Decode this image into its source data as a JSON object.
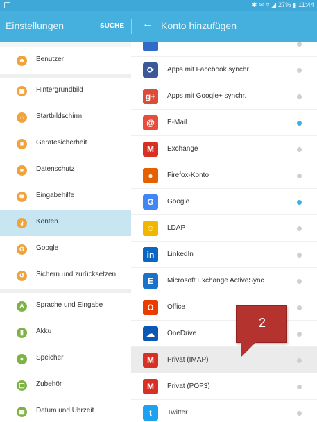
{
  "status": {
    "right": "✱ ✉ ▿ ◢ 27% ▮ 11:44"
  },
  "appbar": {
    "title": "Einstellungen",
    "search": "SUCHE",
    "back": "←",
    "subtitle": "Konto hinzufügen"
  },
  "left_items": [
    {
      "label": "Benutzer",
      "glyph": "☻"
    },
    {
      "label": "Hintergrundbild",
      "glyph": "▣"
    },
    {
      "label": "Startbildschirm",
      "glyph": "⌂"
    },
    {
      "label": "Gerätesicherheit",
      "glyph": "■"
    },
    {
      "label": "Datenschutz",
      "glyph": "■"
    },
    {
      "label": "Eingabehilfe",
      "glyph": "✱"
    },
    {
      "label": "Konten",
      "glyph": "⚷"
    },
    {
      "label": "Google",
      "glyph": "G"
    },
    {
      "label": "Sichern und zurücksetzen",
      "glyph": "↺"
    },
    {
      "label": "Sprache und Eingabe",
      "glyph": "A"
    },
    {
      "label": "Akku",
      "glyph": "▮"
    },
    {
      "label": "Speicher",
      "glyph": "●"
    },
    {
      "label": "Zubehör",
      "glyph": "◫"
    },
    {
      "label": "Datum und Uhrzeit",
      "glyph": "▦"
    }
  ],
  "right_items": [
    {
      "label": "Apps mit Facebook synchr.",
      "glyph": "⟳",
      "color": "#3b5998",
      "active": false
    },
    {
      "label": "Apps mit Google+ synchr.",
      "glyph": "g+",
      "color": "#dd4b39",
      "active": false
    },
    {
      "label": "E-Mail",
      "glyph": "@",
      "color": "#e74c3c",
      "active": true
    },
    {
      "label": "Exchange",
      "glyph": "M",
      "color": "#d93025",
      "active": false
    },
    {
      "label": "Firefox-Konto",
      "glyph": "●",
      "color": "#e66000",
      "active": false
    },
    {
      "label": "Google",
      "glyph": "G",
      "color": "#4285f4",
      "active": true
    },
    {
      "label": "LDAP",
      "glyph": "☺",
      "color": "#f2b600",
      "active": false
    },
    {
      "label": "LinkedIn",
      "glyph": "in",
      "color": "#0a66c2",
      "active": false
    },
    {
      "label": "Microsoft Exchange ActiveSync",
      "glyph": "E",
      "color": "#1a73c8",
      "active": false
    },
    {
      "label": "Office",
      "glyph": "O",
      "color": "#eb3c00",
      "active": false
    },
    {
      "label": "OneDrive",
      "glyph": "☁",
      "color": "#0a58b6",
      "active": false
    },
    {
      "label": "Privat (IMAP)",
      "glyph": "M",
      "color": "#d93025",
      "active": false
    },
    {
      "label": "Privat (POP3)",
      "glyph": "M",
      "color": "#d93025",
      "active": false
    },
    {
      "label": "Twitter",
      "glyph": "t",
      "color": "#1da1f2",
      "active": false
    }
  ],
  "callout": {
    "number": "2"
  }
}
